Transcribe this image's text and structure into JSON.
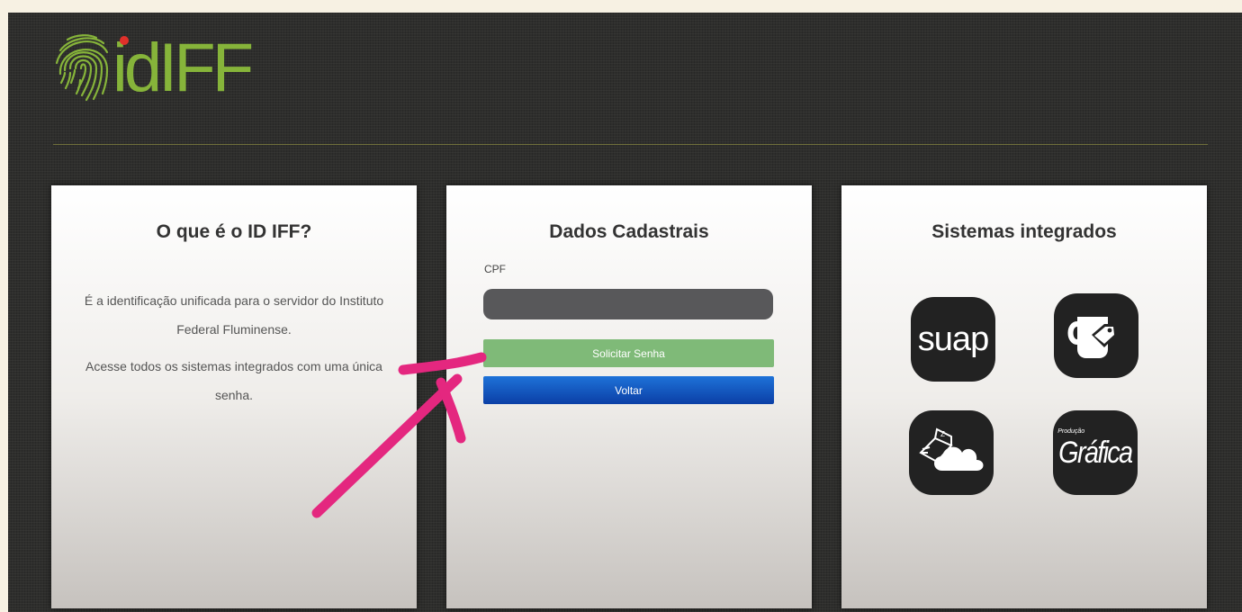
{
  "logo": {
    "text": "idIFF",
    "icon": "fingerprint-icon",
    "colors": {
      "green": "#86b43a",
      "red_dot": "#e0302a"
    }
  },
  "panels": {
    "about": {
      "title": "O que é o ID IFF?",
      "paragraph1": "É a identificação unificada para o servidor do Instituto Federal Fluminense.",
      "paragraph2": "Acesse todos os sistemas integrados com uma única senha."
    },
    "form": {
      "title": "Dados Cadastrais",
      "cpf_label": "CPF",
      "cpf_value": "",
      "cpf_placeholder": "",
      "request_password_label": "Solicitar Senha",
      "back_label": "Voltar"
    },
    "systems": {
      "title": "Sistemas integrados",
      "apps": [
        {
          "label": "suap",
          "icon": "suap-icon"
        },
        {
          "label": "",
          "icon": "mug-tag-icon"
        },
        {
          "label": "",
          "icon": "box-cloud-icon"
        },
        {
          "label": "Gráfica",
          "sublabel": "Produção",
          "icon": "grafica-icon"
        }
      ]
    }
  },
  "annotation": {
    "icon": "pink-arrow-icon",
    "color": "#e4277f"
  },
  "colors": {
    "background": "#2e2e2c",
    "button_green": "#7fba78",
    "button_blue": "#1e72d8",
    "input_dark": "#58585a"
  }
}
